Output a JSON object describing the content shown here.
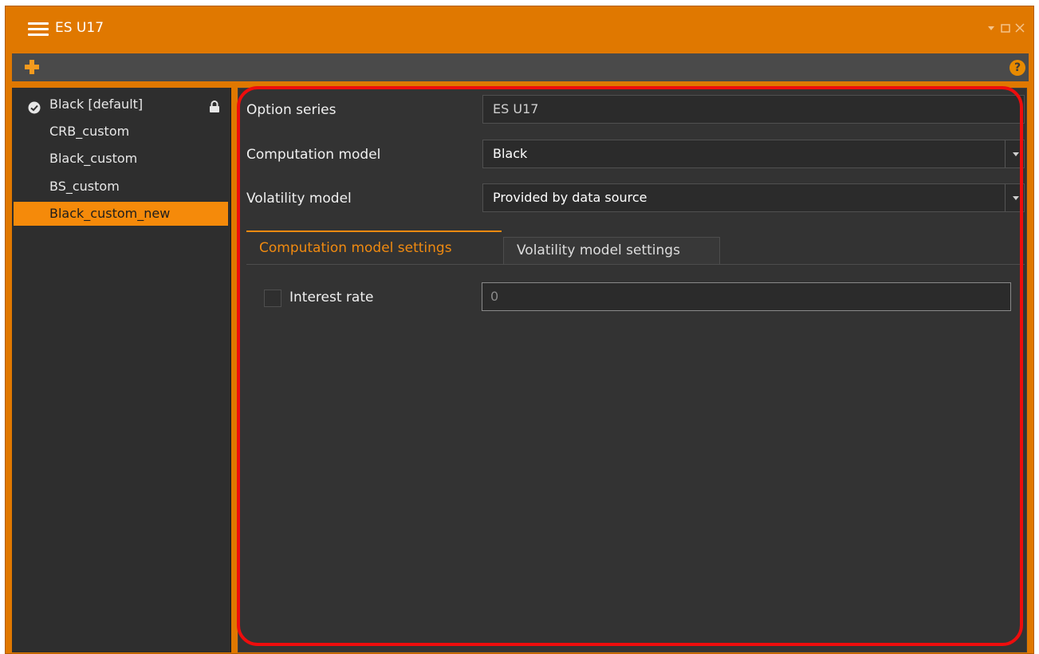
{
  "window": {
    "title": "ES U17",
    "accent_color": "#e07800",
    "controls": [
      "chevron-down-icon",
      "maximize-icon",
      "close-icon"
    ]
  },
  "toolbar": {
    "add_icon": "plus-icon",
    "help_label": "?"
  },
  "sidebar": {
    "items": [
      {
        "label": "Black [default]",
        "checked": true,
        "locked": true,
        "selected": false
      },
      {
        "label": "CRB_custom",
        "checked": false,
        "locked": false,
        "selected": false
      },
      {
        "label": "Black_custom",
        "checked": false,
        "locked": false,
        "selected": false
      },
      {
        "label": "BS_custom",
        "checked": false,
        "locked": false,
        "selected": false
      },
      {
        "label": "Black_custom_new",
        "checked": false,
        "locked": false,
        "selected": true
      }
    ]
  },
  "form": {
    "option_series_label": "Option series",
    "option_series_value": "ES U17",
    "computation_model_label": "Computation model",
    "computation_model_value": "Black",
    "volatility_model_label": "Volatility model",
    "volatility_model_value": "Provided by data source"
  },
  "tabs": [
    {
      "label": "Computation model settings",
      "active": true
    },
    {
      "label": "Volatility model settings",
      "active": false
    }
  ],
  "computation_settings": {
    "interest_rate_label": "Interest rate",
    "interest_rate_checked": false,
    "interest_rate_value": "0"
  },
  "annotation": {
    "highlight_color": "#ee0d0d"
  }
}
